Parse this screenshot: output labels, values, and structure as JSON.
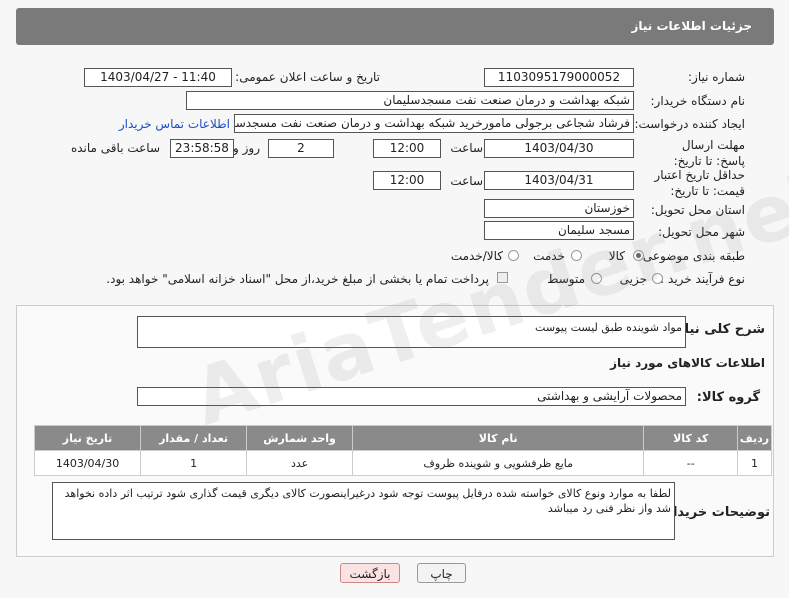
{
  "header": {
    "title": "جزئیات اطلاعات نیاز"
  },
  "form": {
    "need_number_label": "شماره نیاز:",
    "need_number": "1103095179000052",
    "announce_label": "تاریخ و ساعت اعلان عمومی:",
    "announce_value": "1403/04/27 - 11:40",
    "buyer_org_label": "نام دستگاه خریدار:",
    "buyer_org": "شبکه بهداشت و درمان صنعت نفت مسجدسلیمان",
    "creator_label": "ایجاد کننده درخواست:",
    "creator": "فرشاد شجاعی برجولی مامورخرید شبکه بهداشت و درمان صنعت نفت مسجدسلیمان",
    "contact_link": "اطلاعات تماس خریدار",
    "reply_deadline_label": "مهلت ارسال پاسخ: تا تاریخ:",
    "reply_date": "1403/04/30",
    "time_label": "ساعت",
    "reply_time": "12:00",
    "days_value": "2",
    "days_label": "روز و",
    "remaining_time": "23:58:58",
    "remaining_label": "ساعت باقی مانده",
    "price_validity_label": "حداقل تاریخ اعتبار قیمت: تا تاریخ:",
    "price_date": "1403/04/31",
    "price_time": "12:00",
    "province_label": "استان محل تحویل:",
    "province": "خوزستان",
    "city_label": "شهر محل تحویل:",
    "city": "مسجد سلیمان",
    "category_label": "طبقه بندی موضوعی:",
    "category_options": [
      "کالا",
      "خدمت",
      "کالا/خدمت"
    ],
    "process_label": "نوع فرآیند خرید :",
    "process_options": [
      "جزیی",
      "متوسط"
    ],
    "payment_note": "پرداخت تمام یا بخشی از مبلغ خرید،از محل \"اسناد خزانه اسلامی\" خواهد بود."
  },
  "details": {
    "description_label": "شرح کلی نیاز:",
    "description": "مواد شوینده طبق لیست پیوست",
    "goods_info_title": "اطلاعات کالاهای مورد نیاز",
    "goods_group_label": "گروه کالا:",
    "goods_group": "محصولات آرایشی و بهداشتی",
    "table": {
      "headers": [
        "ردیف",
        "کد کالا",
        "نام کالا",
        "واحد شمارش",
        "تعداد / مقدار",
        "تاریخ نیاز"
      ],
      "rows": [
        [
          "1",
          "--",
          "مایع ظرفشویی و شوینده ظروف",
          "عدد",
          "1",
          "1403/04/30"
        ]
      ]
    },
    "buyer_notes_label": "توضیحات خریدار:",
    "buyer_notes": "لطفا به موارد ونوع کالای خواسته شده درفایل پیوست توجه شود درغیراینصورت کالای دیگری قیمت گذاری شود ترتیب اثر داده نخواهد شد واز نظر فنی رد میباشد"
  },
  "buttons": {
    "print": "چاپ",
    "back": "بازگشت"
  },
  "watermark": "AriaTender.neT"
}
